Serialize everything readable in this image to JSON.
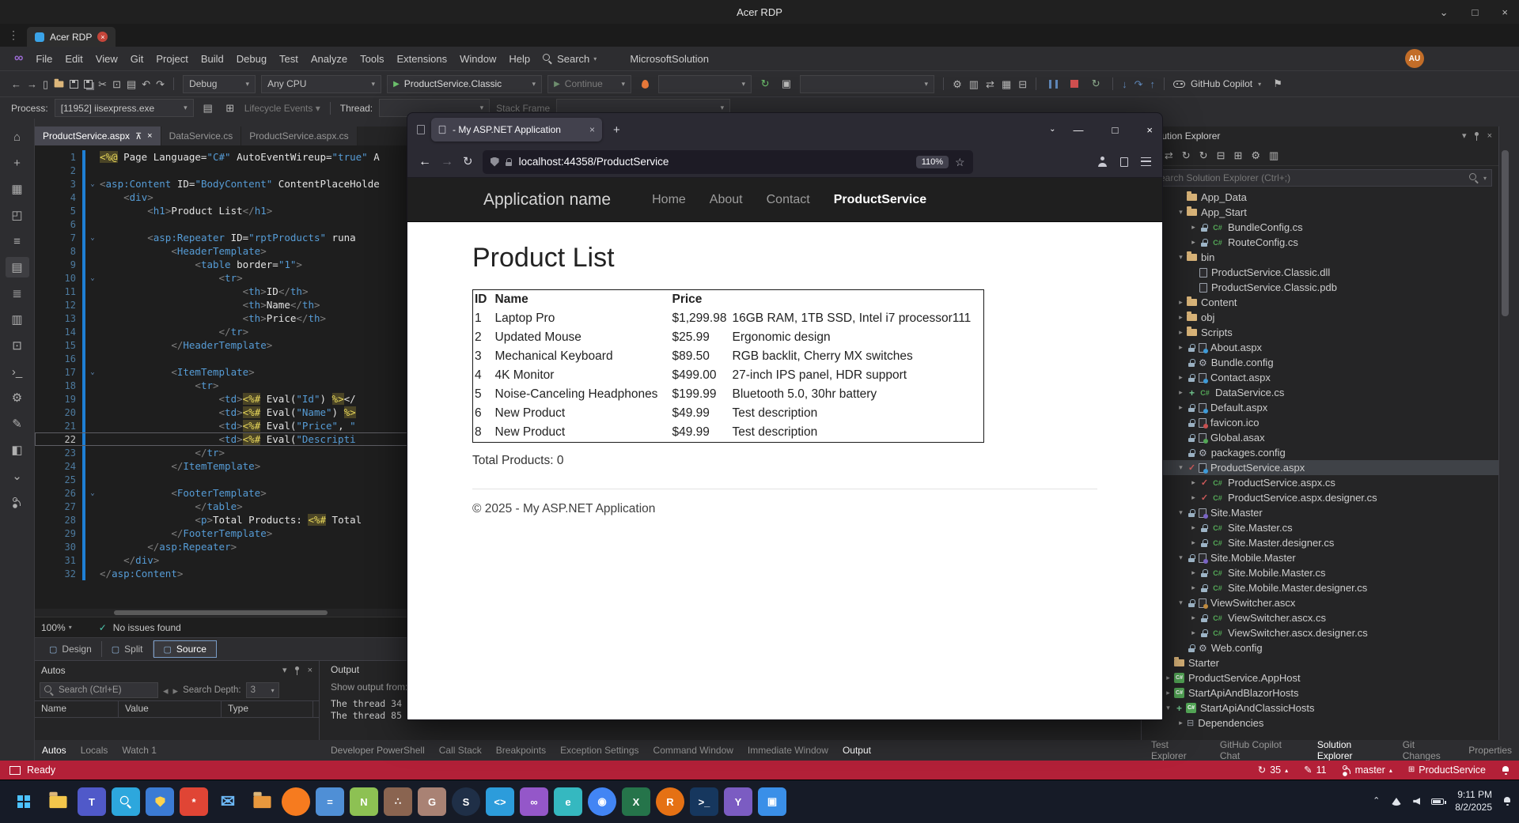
{
  "rdp": {
    "title": "Acer RDP",
    "tab": "Acer RDP",
    "window_controls": [
      "chevron-down",
      "restore",
      "close"
    ]
  },
  "vs": {
    "menus": [
      "File",
      "Edit",
      "View",
      "Git",
      "Project",
      "Build",
      "Debug",
      "Test",
      "Analyze",
      "Tools",
      "Extensions",
      "Window",
      "Help"
    ],
    "search_menu": "Search",
    "solution_menu": "MicrosoftSolution",
    "avatar": "AU",
    "activity_icons": [
      "home",
      "add-item",
      "extensions",
      "fullscreen",
      "list",
      "images",
      "sliders",
      "chart",
      "copy",
      "terminal",
      "settings",
      "tools",
      "package",
      "expand-all",
      "git-branch"
    ],
    "toolbar": {
      "icons_left": [
        "nav-back",
        "nav-forward",
        "new-file",
        "open-folder",
        "save",
        "save-all",
        "cut",
        "copy",
        "paste",
        "undo",
        "redo"
      ],
      "debug_combo": "Debug",
      "platform_combo": "Any CPU",
      "run_combo": "ProductService.Classic",
      "continue_combo": "Continue",
      "icons_mid": [
        "hot-reload",
        "refresh",
        "screenshot"
      ],
      "icons_tools": [
        "wrench",
        "editor-layout",
        "compare",
        "columns",
        "monitor"
      ],
      "debug_icons": [
        "pause",
        "stop",
        "restart"
      ],
      "step_icons": [
        "step-into",
        "step-over",
        "step-out"
      ],
      "copilot": "GitHub Copilot",
      "feedback_icon": "feedback"
    },
    "process": {
      "label": "Process:",
      "value": "[11952] iisexpress.exe",
      "icons": [
        "list-view",
        "windows"
      ],
      "lifecycle": "Lifecycle Events",
      "thread": "Thread:",
      "stack": "Stack Frame"
    },
    "editor": {
      "tabs": [
        {
          "label": "ProductService.aspx",
          "active": true
        },
        {
          "label": "DataService.cs",
          "active": false
        },
        {
          "label": "ProductService.aspx.cs",
          "active": false
        }
      ],
      "current_line": 22,
      "folds": [
        3,
        7,
        10,
        17,
        26
      ],
      "lines": [
        "<%@ Page Language=\"C#\" AutoEventWireup=\"true\" A",
        "",
        "<asp:Content ID=\"BodyContent\" ContentPlaceHolde",
        "    <div>",
        "        <h1>Product List</h1>",
        "",
        "        <asp:Repeater ID=\"rptProducts\" runa",
        "            <HeaderTemplate>",
        "                <table border=\"1\">",
        "                    <tr>",
        "                        <th>ID</th>",
        "                        <th>Name</th>",
        "                        <th>Price</th>",
        "                    </tr>",
        "            </HeaderTemplate>",
        "",
        "            <ItemTemplate>",
        "                <tr>",
        "                    <td><%# Eval(\"Id\") %></",
        "                    <td><%# Eval(\"Name\") %>",
        "                    <td><%# Eval(\"Price\", \"",
        "                    <td><%# Eval(\"Descripti",
        "                </tr>",
        "            </ItemTemplate>",
        "",
        "            <FooterTemplate>",
        "                </table>",
        "                <p>Total Products: <%# Total",
        "            </FooterTemplate>",
        "        </asp:Repeater>",
        "    </div>",
        "</asp:Content>"
      ],
      "zoom": "100%",
      "issues": "No issues found",
      "views": [
        "Design",
        "Split",
        "Source"
      ],
      "active_view": "Source"
    },
    "autos": {
      "title": "Autos",
      "search_placeholder": "Search (Ctrl+E)",
      "depth_label": "Search Depth:",
      "depth": "3",
      "columns": [
        "Name",
        "Value",
        "Type"
      ]
    },
    "output": {
      "title": "Output",
      "from_label": "Show output from:",
      "lines": [
        "The thread 34",
        "The thread 85"
      ]
    },
    "tabs_left": [
      "Autos",
      "Locals",
      "Watch 1"
    ],
    "tabs_mid": [
      "Developer PowerShell",
      "Call Stack",
      "Breakpoints",
      "Exception Settings",
      "Command Window",
      "Immediate Window",
      "Output"
    ],
    "tabs_right": [
      "Test Explorer",
      "GitHub Copilot Chat",
      "Solution Explorer",
      "Git Changes",
      "Properties"
    ],
    "active_left": "Autos",
    "active_mid": "Output",
    "active_right": "Solution Explorer",
    "solution_explorer": {
      "title": "Solution Explorer",
      "controls": [
        "chevron-down",
        "pin",
        "close"
      ],
      "toolbar_icons": [
        "home",
        "switch-views",
        "sync",
        "refresh",
        "collapse-all",
        "show-all-files",
        "properties",
        "preview"
      ],
      "search_placeholder": "Search Solution Explorer (Ctrl+;)",
      "tree": [
        [
          "App_Data",
          1,
          "",
          "folder",
          ""
        ],
        [
          "App_Start",
          1,
          "d",
          "folder",
          ""
        ],
        [
          "BundleConfig.cs",
          2,
          "r",
          "cs",
          "lock"
        ],
        [
          "RouteConfig.cs",
          2,
          "r",
          "cs",
          "lock"
        ],
        [
          "bin",
          1,
          "d",
          "folder",
          ""
        ],
        [
          "ProductService.Classic.dll",
          2,
          "",
          "file",
          ""
        ],
        [
          "ProductService.Classic.pdb",
          2,
          "",
          "file",
          ""
        ],
        [
          "Content",
          1,
          "r",
          "folder",
          ""
        ],
        [
          "obj",
          1,
          "r",
          "folder",
          ""
        ],
        [
          "Scripts",
          1,
          "r",
          "folder",
          ""
        ],
        [
          "About.aspx",
          1,
          "r",
          "aspx",
          "lock"
        ],
        [
          "Bundle.config",
          1,
          "",
          "config",
          "lock"
        ],
        [
          "Contact.aspx",
          1,
          "r",
          "aspx",
          "lock"
        ],
        [
          "DataService.cs",
          1,
          "r",
          "cs",
          "plus"
        ],
        [
          "Default.aspx",
          1,
          "r",
          "aspx",
          "lock"
        ],
        [
          "favicon.ico",
          1,
          "",
          "ico",
          "lock"
        ],
        [
          "Global.asax",
          1,
          "",
          "asax",
          "lock"
        ],
        [
          "packages.config",
          1,
          "",
          "config",
          "lock"
        ],
        [
          "ProductService.aspx",
          1,
          "d",
          "aspx",
          "check",
          true
        ],
        [
          "ProductService.aspx.cs",
          2,
          "r",
          "cs",
          "check"
        ],
        [
          "ProductService.aspx.designer.cs",
          2,
          "r",
          "cs",
          "check"
        ],
        [
          "Site.Master",
          1,
          "d",
          "master",
          "lock"
        ],
        [
          "Site.Master.cs",
          2,
          "r",
          "cs",
          "lock"
        ],
        [
          "Site.Master.designer.cs",
          2,
          "r",
          "cs",
          "lock"
        ],
        [
          "Site.Mobile.Master",
          1,
          "d",
          "master",
          "lock"
        ],
        [
          "Site.Mobile.Master.cs",
          2,
          "r",
          "cs",
          "lock"
        ],
        [
          "Site.Mobile.Master.designer.cs",
          2,
          "r",
          "cs",
          "lock"
        ],
        [
          "ViewSwitcher.ascx",
          1,
          "d",
          "ascx",
          "lock"
        ],
        [
          "ViewSwitcher.ascx.cs",
          2,
          "r",
          "cs",
          "lock"
        ],
        [
          "ViewSwitcher.ascx.designer.cs",
          2,
          "r",
          "cs",
          "lock"
        ],
        [
          "Web.config",
          1,
          "",
          "config",
          "lock"
        ],
        [
          "Starter",
          0,
          "",
          "folder",
          ""
        ],
        [
          "ProductService.AppHost",
          0,
          "r",
          "project",
          ""
        ],
        [
          "StartApiAndBlazorHosts",
          0,
          "r",
          "project",
          ""
        ],
        [
          "StartApiAndClassicHosts",
          0,
          "d",
          "project",
          "plus"
        ],
        [
          "Dependencies",
          1,
          "r",
          "deps",
          ""
        ]
      ]
    },
    "status": {
      "ready": "Ready",
      "sync_count": "35",
      "edit_count": "11",
      "branch": "master",
      "project": "ProductService"
    }
  },
  "browser": {
    "tab_title": "- My ASP.NET Application",
    "url": "localhost:44358/ProductService",
    "zoom": "110%",
    "page": {
      "brand": "Application name",
      "nav": [
        "Home",
        "About",
        "Contact",
        "ProductService"
      ],
      "active_nav": "ProductService",
      "heading": "Product List",
      "table": {
        "headers": [
          "ID",
          "Name",
          "Price"
        ],
        "rows": [
          [
            "1",
            "Laptop Pro",
            "$1,299.98",
            "16GB RAM, 1TB SSD, Intel i7 processor111"
          ],
          [
            "2",
            "Updated Mouse",
            "$25.99",
            "Ergonomic design"
          ],
          [
            "3",
            "Mechanical Keyboard",
            "$89.50",
            "RGB backlit, Cherry MX switches"
          ],
          [
            "4",
            "4K Monitor",
            "$499.00",
            "27-inch IPS panel, HDR support"
          ],
          [
            "5",
            "Noise-Canceling Headphones",
            "$199.99",
            "Bluetooth 5.0, 30hr battery"
          ],
          [
            "6",
            "New Product",
            "$49.99",
            "Test description"
          ],
          [
            "8",
            "New Product",
            "$49.99",
            "Test description"
          ]
        ]
      },
      "total_label": "Total Products: 0",
      "footer": "© 2025 - My ASP.NET Application"
    }
  },
  "taskbar": {
    "time": "9:11 PM",
    "date": "8/2/2025",
    "items": [
      {
        "name": "start",
        "color": "transparent"
      },
      {
        "name": "file-explorer",
        "color": "transparent"
      },
      {
        "name": "teams",
        "color": "#5059c9"
      },
      {
        "name": "search-app",
        "color": "#2da7dd"
      },
      {
        "name": "defender",
        "color": "#3b7bd4"
      },
      {
        "name": "molecule-app",
        "color": "#e04535"
      },
      {
        "name": "mail",
        "color": "transparent"
      },
      {
        "name": "downloads-folder",
        "color": "transparent"
      },
      {
        "name": "firefox",
        "color": "#f67b1f"
      },
      {
        "name": "calculator",
        "color": "#4f8fd6"
      },
      {
        "name": "notepad-plus-plus",
        "color": "#8dc153"
      },
      {
        "name": "paw-app",
        "color": "#8a6450"
      },
      {
        "name": "gimp",
        "color": "#a98274"
      },
      {
        "name": "steam",
        "color": "#1f2f47"
      },
      {
        "name": "vscode",
        "color": "#2c9cdb"
      },
      {
        "name": "visual-studio",
        "color": "#9457c9"
      },
      {
        "name": "edge",
        "color": "#35b8c0"
      },
      {
        "name": "chrome",
        "color": "#4285f4"
      },
      {
        "name": "excel",
        "color": "#25744a"
      },
      {
        "name": "rust-app",
        "color": "#e57114"
      },
      {
        "name": "terminal",
        "color": "#16375e"
      },
      {
        "name": "github-desktop",
        "color": "#7b5cc2"
      },
      {
        "name": "photos",
        "color": "#3a8fe8"
      }
    ]
  }
}
